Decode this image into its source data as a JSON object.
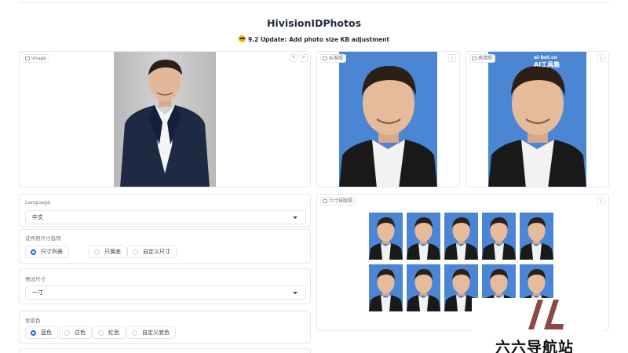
{
  "header": {
    "title": "HivisionIDPhotos",
    "subtitle": "9.2 Update: Add photo size KB adjustment"
  },
  "input_image": {
    "label": "Image"
  },
  "outputs": {
    "standard_label": "标准照",
    "hd_label": "高清照",
    "layout_label": "六寸排版照",
    "hd_watermark_line1": "ai-bot.cn",
    "hd_watermark_line2": "AI工具集"
  },
  "form": {
    "language": {
      "label": "Language",
      "value": "中文"
    },
    "size_option": {
      "label": "证件照尺寸选项",
      "options": [
        "尺寸列表",
        "只换底",
        "自定义尺寸"
      ],
      "selected": "尺寸列表"
    },
    "preset_size": {
      "label": "预设尺寸",
      "value": "一寸"
    },
    "background": {
      "label": "背景色",
      "options": [
        "蓝色",
        "白色",
        "红色",
        "自定义底色"
      ],
      "selected": "蓝色"
    }
  },
  "site_watermark": {
    "text": "六六导航站"
  },
  "colors": {
    "accent": "#2563eb",
    "photo_blue": "#4a86d4",
    "brand_mark": "#8a4a43"
  },
  "icons": {
    "panel_label": "image-icon",
    "edit": "pencil-icon",
    "close": "close-icon",
    "download": "download-icon"
  }
}
